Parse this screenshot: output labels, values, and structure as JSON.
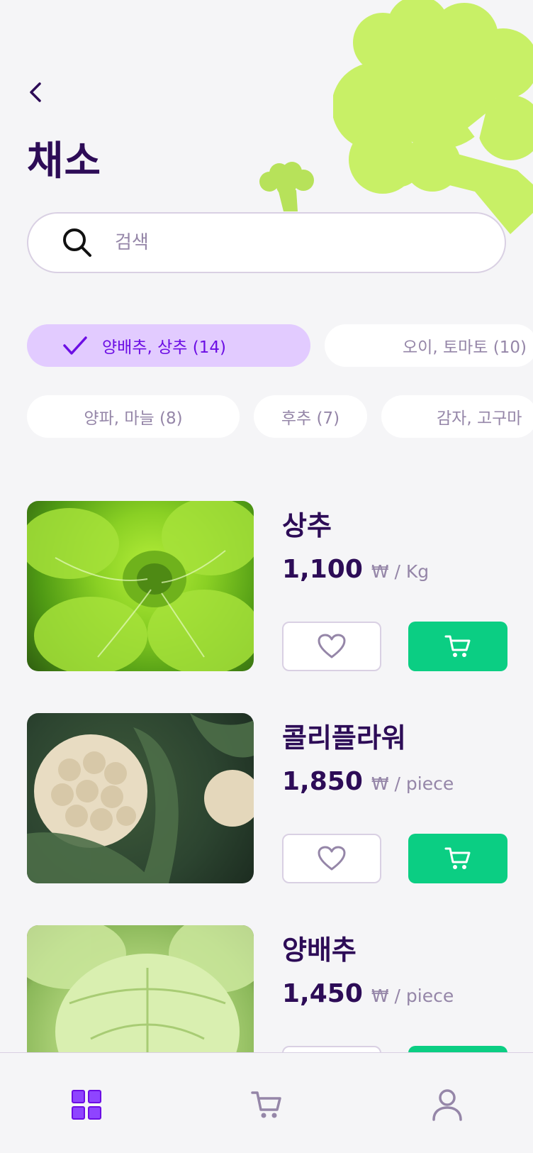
{
  "header": {
    "back_icon": "chevron-left-icon",
    "title": "채소"
  },
  "search": {
    "placeholder": "검색",
    "value": "",
    "icon": "search-icon"
  },
  "filters": [
    {
      "label": "양배추, 상추 (14)",
      "selected": true
    },
    {
      "label": "오이, 토마토 (10)",
      "selected": false
    },
    {
      "label": "양파, 마늘 (8)",
      "selected": false
    },
    {
      "label": "후추 (7)",
      "selected": false
    },
    {
      "label": "감자, 고구마",
      "selected": false
    }
  ],
  "products": [
    {
      "name": "상추",
      "price": "1,100",
      "unit": "₩ / Kg"
    },
    {
      "name": "콜리플라워",
      "price": "1,850",
      "unit": "₩ / piece"
    },
    {
      "name": "양배추",
      "price": "1,450",
      "unit": "₩ / piece"
    }
  ],
  "tabbar": [
    {
      "icon": "grid-icon",
      "active": true
    },
    {
      "icon": "cart-icon",
      "active": false
    },
    {
      "icon": "profile-icon",
      "active": false
    }
  ],
  "colors": {
    "primary_dark": "#2d0c57",
    "secondary_text": "#9586a8",
    "accent_purple": "#6c0ee4",
    "chip_selected": "#e2cbff",
    "cart_green": "#0bce83",
    "deco_green": "#cdf266"
  }
}
